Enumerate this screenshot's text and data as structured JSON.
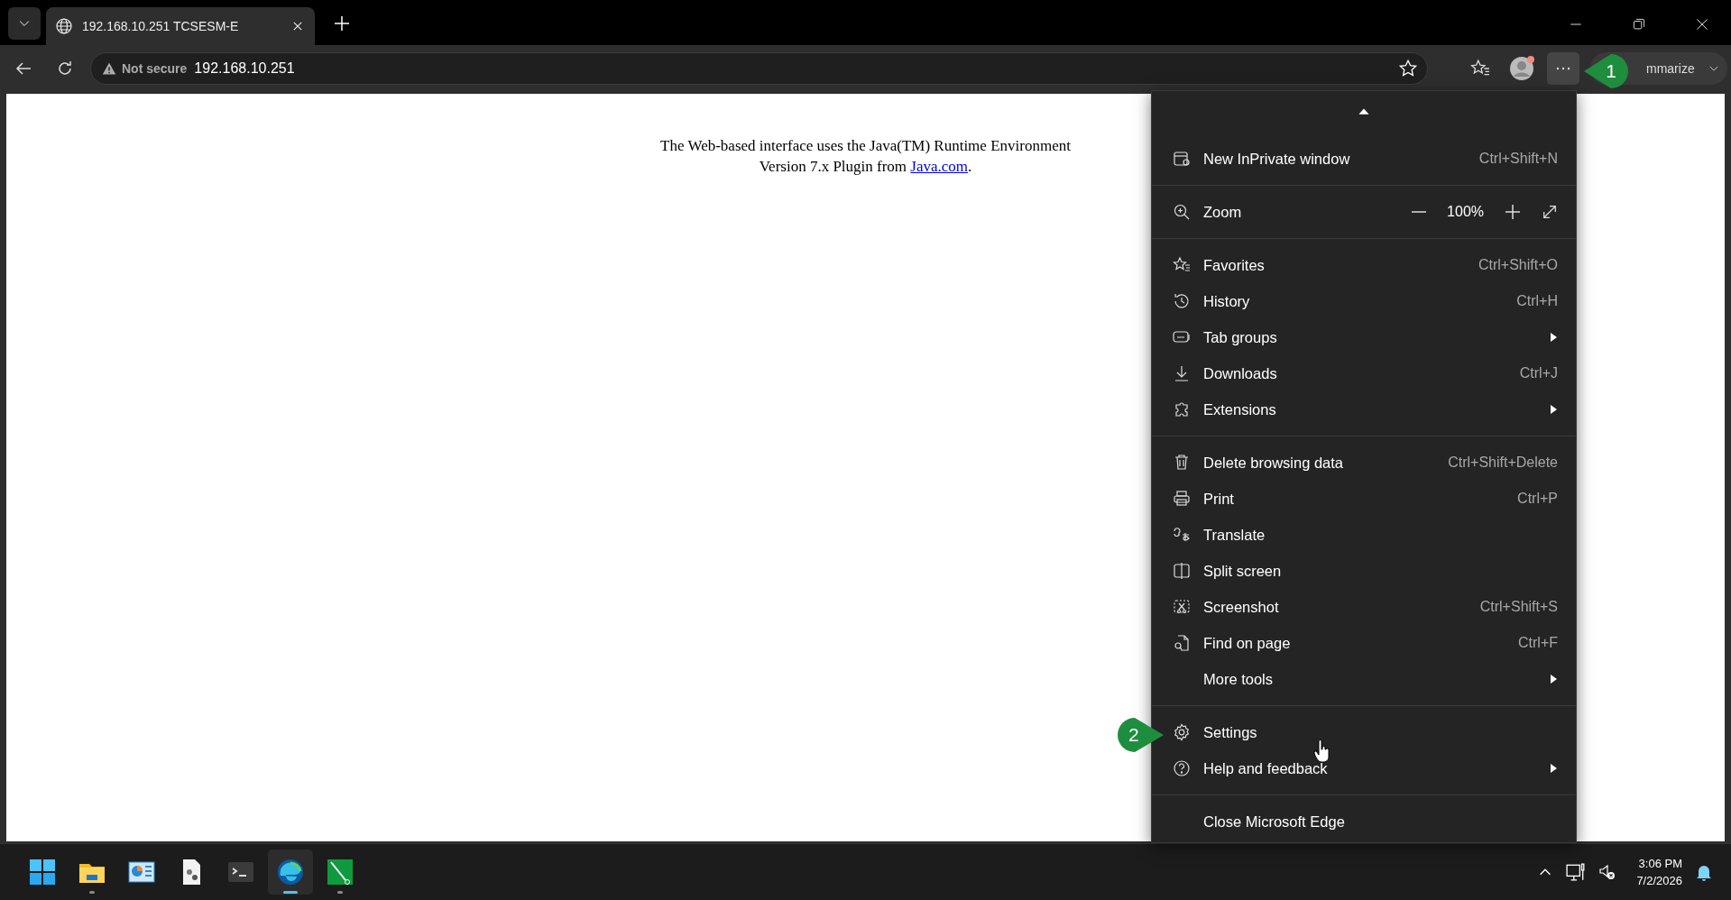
{
  "tab_strip": {
    "tabs": [
      {
        "title": "192.168.10.251 TCSESM-E",
        "selected": true
      }
    ]
  },
  "address_bar": {
    "security": "Not secure",
    "url": "192.168.10.251"
  },
  "toolbar": {
    "more_selected": true,
    "summarize": "mmarize"
  },
  "page": {
    "line_1": "The Web-based interface uses the Java(TM) Runtime Environment",
    "line_2": "Version 7.x Plugin from ",
    "link": "Java.com",
    "after_link": "."
  },
  "menu": {
    "sections": [
      {
        "items": [
          {
            "kind": "item",
            "label": "New InPrivate window",
            "shortcut": "Ctrl+Shift+N",
            "submenu": false
          }
        ]
      },
      {
        "items": [
          {
            "kind": "zoom",
            "label": "Zoom",
            "reading": "100%"
          }
        ]
      },
      {
        "items": [
          {
            "kind": "item",
            "label": "Favorites",
            "shortcut": "Ctrl+Shift+O",
            "submenu": false
          },
          {
            "kind": "item",
            "label": "History",
            "shortcut": "Ctrl+H",
            "submenu": false
          },
          {
            "kind": "item",
            "label": "Tab groups",
            "submenu": true
          },
          {
            "kind": "item",
            "label": "Downloads",
            "shortcut": "Ctrl+J",
            "submenu": false
          },
          {
            "kind": "item",
            "label": "Extensions",
            "submenu": true
          }
        ]
      },
      {
        "items": [
          {
            "kind": "item",
            "label": "Delete browsing data",
            "shortcut": "Ctrl+Shift+Delete",
            "submenu": false
          },
          {
            "kind": "item",
            "label": "Print",
            "shortcut": "Ctrl+P",
            "submenu": false
          },
          {
            "kind": "item",
            "label": "Translate",
            "submenu": false
          },
          {
            "kind": "item",
            "label": "Split screen",
            "submenu": false
          },
          {
            "kind": "item",
            "label": "Screenshot",
            "shortcut": "Ctrl+Shift+S",
            "submenu": false
          },
          {
            "kind": "item",
            "label": "Find on page",
            "shortcut": "Ctrl+F",
            "submenu": false
          },
          {
            "kind": "item",
            "label": "More tools",
            "submenu": true
          }
        ]
      },
      {
        "items": [
          {
            "kind": "item",
            "label": "Settings",
            "submenu": false
          },
          {
            "kind": "item",
            "label": "Help and feedback",
            "submenu": true
          }
        ]
      },
      {
        "items": [
          {
            "kind": "item",
            "label": "Close Microsoft Edge",
            "submenu": false
          }
        ]
      }
    ]
  },
  "callouts": [
    {
      "number": "1"
    },
    {
      "number": "2"
    }
  ],
  "taskbar": {
    "apps": [
      {
        "selected": false,
        "running": false
      },
      {
        "selected": false,
        "running": true
      },
      {
        "selected": false,
        "running": false
      },
      {
        "selected": false,
        "running": false
      },
      {
        "selected": false,
        "running": false
      },
      {
        "selected": true,
        "running": true
      },
      {
        "selected": false,
        "running": true
      }
    ],
    "time": "3:06 PM",
    "date": "7/2/2026"
  }
}
